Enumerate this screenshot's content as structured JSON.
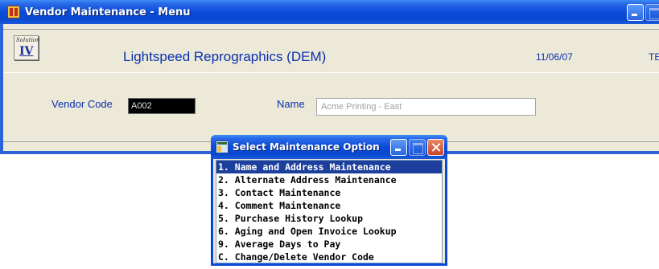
{
  "main_window": {
    "title": "Vendor Maintenance - Menu",
    "company_name": "Lightspeed Reprographics (DEM)",
    "date": "11/06/07",
    "user_initials": "TE",
    "logo": {
      "top_text": "Solution",
      "main_text": "IV"
    },
    "vendor_code": {
      "label": "Vendor Code",
      "value": "A002"
    },
    "name": {
      "label": "Name",
      "value": "Acme Printing - East"
    }
  },
  "dialog": {
    "title": "Select Maintenance Option",
    "selected_index": 0,
    "options": [
      "1. Name and Address Maintenance",
      "2. Alternate Address Maintenance",
      "3. Contact Maintenance",
      "4. Comment Maintenance",
      "5. Purchase History Lookup",
      "6. Aging and Open Invoice Lookup",
      "9. Average Days to Pay",
      "C. Change/Delete Vendor Code"
    ]
  },
  "colors": {
    "titlebar": "#0a4ad9",
    "label_text": "#0c2fb0",
    "selection": "#1c3f9e",
    "window_bg": "#ece9d8"
  }
}
